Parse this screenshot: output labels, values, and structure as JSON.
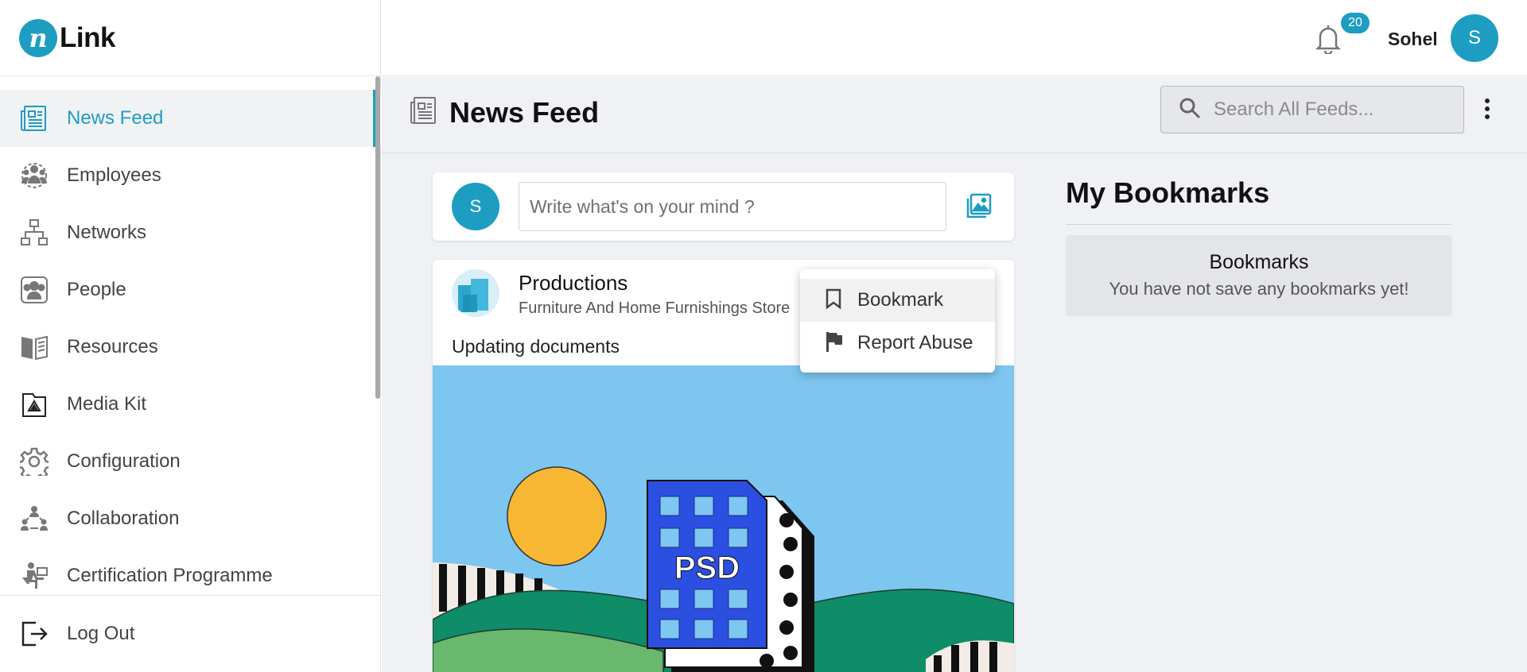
{
  "brand": {
    "letter": "n",
    "name": "Link",
    "accent": "#1e9dc2"
  },
  "sidebar": {
    "items": [
      {
        "label": "News Feed",
        "icon": "newspaper-icon",
        "active": true
      },
      {
        "label": "Employees",
        "icon": "employees-icon"
      },
      {
        "label": "Networks",
        "icon": "network-icon"
      },
      {
        "label": "People",
        "icon": "people-icon"
      },
      {
        "label": "Resources",
        "icon": "book-icon"
      },
      {
        "label": "Media Kit",
        "icon": "media-folder-icon"
      },
      {
        "label": "Configuration",
        "icon": "gear-icon"
      },
      {
        "label": "Collaboration",
        "icon": "collaboration-icon"
      },
      {
        "label": "Certification Programme",
        "icon": "certificate-icon"
      }
    ],
    "logout_label": "Log Out"
  },
  "header": {
    "notification_count": "20",
    "user_name": "Sohel",
    "user_initial": "S"
  },
  "page": {
    "title": "News Feed",
    "search_placeholder": "Search All Feeds..."
  },
  "composer": {
    "avatar_initial": "S",
    "placeholder": "Write what's on your mind ?"
  },
  "post": {
    "author": "Productions",
    "subtitle": "Furniture And Home Furnishings Store",
    "text": "Updating documents",
    "image_label": "PSD"
  },
  "menu": {
    "items": [
      {
        "label": "Bookmark",
        "icon": "bookmark-icon"
      },
      {
        "label": "Report Abuse",
        "icon": "flag-icon"
      }
    ]
  },
  "bookmarks": {
    "title": "My Bookmarks",
    "box_title": "Bookmarks",
    "empty_text": "You have not save any bookmarks yet!"
  }
}
